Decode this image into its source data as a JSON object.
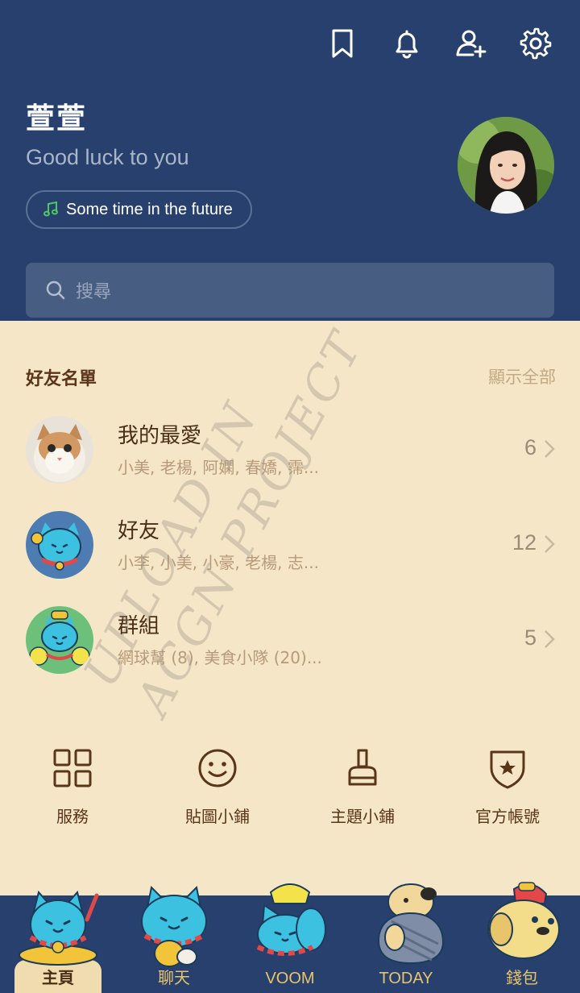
{
  "header": {
    "profile_name": "萱萱",
    "status_message": "Good luck to you",
    "music": "Some time in the future",
    "icons": [
      "bookmark-icon",
      "bell-icon",
      "add-friend-icon",
      "settings-icon"
    ]
  },
  "search": {
    "placeholder": "搜尋"
  },
  "friends": {
    "title": "好友名單",
    "show_all": "顯示全部",
    "rows": [
      {
        "title": "我的最愛",
        "members": "小美, 老楊, 阿嫻, 春嬌, 霈...",
        "count": "6"
      },
      {
        "title": "好友",
        "members": "小李, 小美, 小豪, 老楊, 志...",
        "count": "12"
      },
      {
        "title": "群組",
        "members": "網球幫 (8), 美食小隊 (20)...",
        "count": "5"
      }
    ]
  },
  "watermark": [
    "UPLOAD IN",
    "ACGN PROJECT"
  ],
  "services": [
    {
      "label": "服務",
      "icon": "grid-icon"
    },
    {
      "label": "貼圖小鋪",
      "icon": "smiley-icon"
    },
    {
      "label": "主題小鋪",
      "icon": "brush-icon"
    },
    {
      "label": "官方帳號",
      "icon": "shield-star-icon"
    }
  ],
  "nav": [
    {
      "label": "主頁",
      "active": true
    },
    {
      "label": "聊天",
      "active": false
    },
    {
      "label": "VOOM",
      "active": false
    },
    {
      "label": "TODAY",
      "active": false
    },
    {
      "label": "錢包",
      "active": false
    }
  ],
  "colors": {
    "header_bg": "#28406e",
    "body_bg": "#f5e6c8",
    "accent_text": "#5a3518",
    "nav_label": "#e8c46a"
  }
}
